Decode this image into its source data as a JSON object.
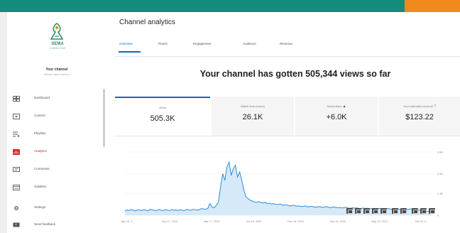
{
  "brand": {
    "name": "SEMA",
    "tagline": "CONSULTING",
    "top_accent": "#f08a1c",
    "top_bar": "#138c7e"
  },
  "channel": {
    "name": "Your channel",
    "subtitle": "Website Name Advisors"
  },
  "sidebar": {
    "items": [
      {
        "label": "Dashboard",
        "icon": "dashboard-icon"
      },
      {
        "label": "Content",
        "icon": "content-icon"
      },
      {
        "label": "Playlists",
        "icon": "playlists-icon"
      },
      {
        "label": "Analytics",
        "icon": "analytics-icon",
        "active": true
      },
      {
        "label": "Comments",
        "icon": "comments-icon"
      },
      {
        "label": "Subtitles",
        "icon": "subtitles-icon"
      },
      {
        "label": "Settings",
        "icon": "settings-icon"
      },
      {
        "label": "Send feedback",
        "icon": "feedback-icon"
      }
    ]
  },
  "page": {
    "title": "Channel analytics"
  },
  "tabs": [
    {
      "label": "Overview",
      "active": true
    },
    {
      "label": "Reach"
    },
    {
      "label": "Engagement"
    },
    {
      "label": "Audience"
    },
    {
      "label": "Revenue"
    }
  ],
  "headline": "Your channel has gotten 505,344 views so far",
  "metrics": [
    {
      "label": "Views",
      "value": "505.3K",
      "selected": true
    },
    {
      "label": "Watch time (hours)",
      "value": "26.1K"
    },
    {
      "label": "Subscribers",
      "value": "+6.0K",
      "indicator": "▲"
    },
    {
      "label": "Your estimated revenue",
      "value": "$123.22",
      "help": "?"
    }
  ],
  "chart_data": {
    "type": "area",
    "title": "",
    "xlabel": "",
    "ylabel": "",
    "x_ticks": [
      "Apr 16, 2...",
      "Sep 17, 2019",
      "Mar 17, 2020",
      "Jun 18, 2020",
      "Dec 19, 2020",
      "Sep 26, 2020",
      "May 22, 2021",
      "Oct 23, 2..."
    ],
    "y_ticks": [
      "3.8K",
      "2.5K",
      "1.3K",
      "0"
    ],
    "ylim": [
      0,
      3800
    ],
    "grid": true,
    "color": "#2a8fd8",
    "fill": "#d6e9f8",
    "x": [
      0,
      3,
      6,
      9,
      12,
      15,
      18,
      21,
      24,
      27,
      30,
      33,
      36,
      39,
      42,
      45,
      48,
      51,
      54,
      57,
      60,
      63,
      66,
      69,
      72,
      75,
      78,
      81,
      84,
      87,
      90,
      93,
      96,
      99,
      102,
      105,
      108,
      111,
      114,
      117,
      120,
      123,
      126,
      129,
      132,
      135,
      138,
      141,
      144,
      147,
      150,
      153,
      156,
      159,
      162,
      165,
      168,
      171,
      174,
      177,
      180,
      183,
      186,
      189,
      192,
      195,
      198,
      201,
      204,
      207,
      210,
      213,
      216,
      219,
      222,
      225,
      228,
      231,
      234,
      237,
      240,
      243,
      246,
      249,
      252,
      255,
      258,
      261,
      264,
      267,
      270,
      273,
      276,
      279,
      282,
      285,
      288,
      291,
      294,
      297,
      300,
      303,
      306,
      309,
      312,
      315,
      318,
      321,
      324,
      327,
      330,
      333,
      336,
      339,
      342,
      345,
      348,
      351,
      354,
      357,
      360,
      363,
      366,
      369,
      372,
      375,
      378,
      381,
      384,
      387,
      390,
      393,
      396,
      399,
      402,
      405,
      408,
      411,
      414,
      417,
      420,
      423,
      426,
      429,
      432,
      435
    ],
    "values": [
      250,
      320,
      280,
      350,
      300,
      260,
      330,
      310,
      290,
      340,
      300,
      270,
      360,
      320,
      300,
      280,
      350,
      300,
      290,
      330,
      310,
      280,
      340,
      300,
      320,
      290,
      330,
      300,
      280,
      350,
      320,
      300,
      360,
      330,
      310,
      340,
      400,
      380,
      360,
      420,
      700,
      500,
      450,
      600,
      800,
      1700,
      2500,
      2100,
      2900,
      3200,
      2400,
      2800,
      3000,
      2300,
      2600,
      2100,
      1500,
      1100,
      1000,
      900,
      850,
      800,
      780,
      820,
      760,
      740,
      780,
      700,
      720,
      680,
      700,
      660,
      640,
      680,
      620,
      600,
      640,
      580,
      560,
      600,
      580,
      540,
      560,
      520,
      540,
      560,
      500,
      520,
      540,
      500,
      480,
      520,
      500,
      470,
      500,
      520,
      480,
      460,
      500,
      480,
      450,
      470,
      440,
      460,
      480,
      440,
      420,
      450,
      430,
      440,
      420,
      400,
      430,
      410,
      420,
      400,
      390,
      420,
      380,
      400,
      420,
      380,
      360,
      390,
      400,
      370,
      360,
      380,
      400,
      360,
      350,
      380,
      360,
      340,
      370,
      380,
      350,
      300,
      320,
      300,
      280,
      260,
      240,
      230
    ]
  }
}
